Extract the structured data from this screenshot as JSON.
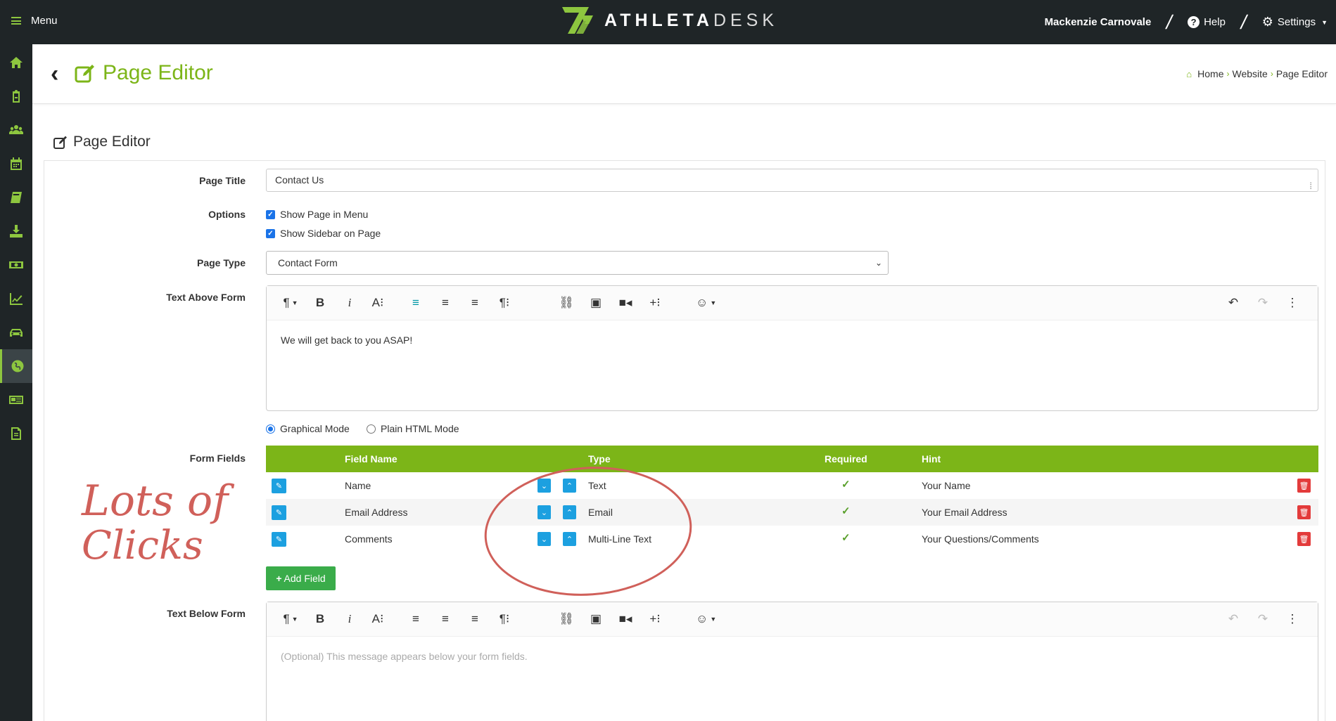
{
  "topbar": {
    "menu_label": "Menu",
    "brand_bold": "ATHLETA",
    "brand_light": "DESK",
    "user_name": "Mackenzie Carnovale",
    "help_label": "Help",
    "settings_label": "Settings"
  },
  "sidebar": {
    "items": [
      {
        "icon": "home-icon"
      },
      {
        "icon": "clipboard-icon"
      },
      {
        "icon": "users-icon"
      },
      {
        "icon": "calendar-icon"
      },
      {
        "icon": "book-icon"
      },
      {
        "icon": "download-icon"
      },
      {
        "icon": "money-icon"
      },
      {
        "icon": "chart-line-icon"
      },
      {
        "icon": "car-icon"
      },
      {
        "icon": "globe-icon",
        "active": true
      },
      {
        "icon": "newspaper-icon"
      },
      {
        "icon": "file-text-icon"
      }
    ]
  },
  "header": {
    "title": "Page Editor",
    "breadcrumb": [
      "Home",
      "Website",
      "Page Editor"
    ]
  },
  "panel": {
    "title": "Page Editor"
  },
  "form": {
    "page_title_label": "Page Title",
    "page_title_value": "Contact Us",
    "options_label": "Options",
    "option_show_menu": "Show Page in Menu",
    "option_show_sidebar": "Show Sidebar on Page",
    "page_type_label": "Page Type",
    "page_type_value": "Contact Form",
    "text_above_label": "Text Above Form",
    "text_above_value": "We will get back to you ASAP!",
    "mode_graphical": "Graphical Mode",
    "mode_html": "Plain HTML Mode",
    "form_fields_label": "Form Fields",
    "text_below_label": "Text Below Form",
    "text_below_placeholder": "(Optional) This message appears below your form fields.",
    "add_field_label": "Add Field"
  },
  "fields_table": {
    "headers": {
      "field_name": "Field Name",
      "type": "Type",
      "required": "Required",
      "hint": "Hint"
    },
    "rows": [
      {
        "name": "Name",
        "type": "Text",
        "required": true,
        "hint": "Your Name"
      },
      {
        "name": "Email Address",
        "type": "Email",
        "required": true,
        "hint": "Your Email Address"
      },
      {
        "name": "Comments",
        "type": "Multi-Line Text",
        "required": true,
        "hint": "Your Questions/Comments"
      }
    ]
  },
  "annotation": {
    "text_line1": "Lots of",
    "text_line2": "Clicks",
    "color": "#d0605a"
  },
  "colors": {
    "brand_green": "#7cb518",
    "dark": "#1f2527",
    "blue": "#1ca0e0",
    "red": "#e33b3b"
  }
}
